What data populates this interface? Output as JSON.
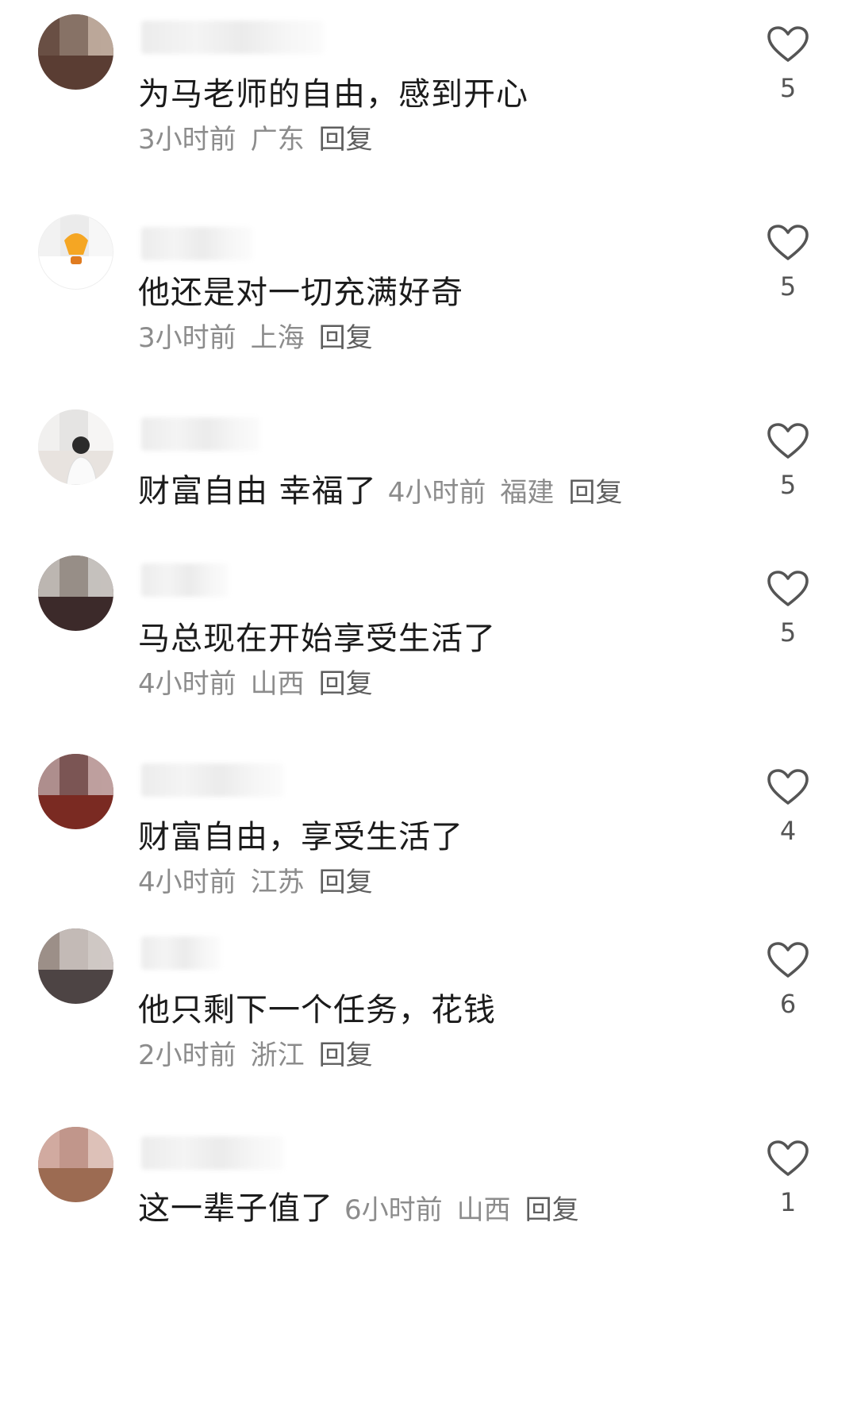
{
  "comments": [
    {
      "text": "为马老师的自由，感到开心",
      "time": "3小时前",
      "location": "广东",
      "reply": "回复",
      "likes": "5",
      "avatar": {
        "colors": [
          "#6b5347",
          "#8e7a6e",
          "#c9b7a8"
        ],
        "base": "#5a3d33"
      }
    },
    {
      "text": "他还是对一切充满好奇",
      "time": "3小时前",
      "location": "上海",
      "reply": "回复",
      "likes": "5",
      "avatar": {
        "colors": [
          "#f1f1f1",
          "#e9e9e9",
          "#f6f6f6"
        ],
        "base": "#ffffff"
      }
    },
    {
      "text": "财富自由 幸福了",
      "time": "4小时前",
      "location": "福建",
      "reply": "回复",
      "likes": "5",
      "avatar": {
        "colors": [
          "#f2f2f2",
          "#e4e4e4",
          "#f7f7f7"
        ],
        "base": "#e8e3df"
      }
    },
    {
      "text": "马总现在开始享受生活了",
      "time": "4小时前",
      "location": "山西",
      "reply": "回复",
      "likes": "5",
      "avatar": {
        "colors": [
          "#cfcac4",
          "#a49d95",
          "#d9d6d2"
        ],
        "base": "#3c2a2a"
      }
    },
    {
      "text": "财富自由，享受生活了",
      "time": "4小时前",
      "location": "江苏",
      "reply": "回复",
      "likes": "4",
      "avatar": {
        "colors": [
          "#b59c9c",
          "#7c5c5c",
          "#c8b0b0"
        ],
        "base": "#7a2a22"
      }
    },
    {
      "text": "他只剩下一个任务，花钱",
      "time": "2小时前",
      "location": "浙江",
      "reply": "回复",
      "likes": "6",
      "avatar": {
        "colors": [
          "#a89a92",
          "#d4cbc6",
          "#e2dbd7"
        ],
        "base": "#4d4444"
      }
    },
    {
      "text": "这一辈子值了",
      "time": "6小时前",
      "location": "山西",
      "reply": "回复",
      "likes": "1",
      "avatar": {
        "colors": [
          "#d9b3ab",
          "#c69d93",
          "#e6cdc7"
        ],
        "base": "#9c6b52"
      }
    }
  ]
}
